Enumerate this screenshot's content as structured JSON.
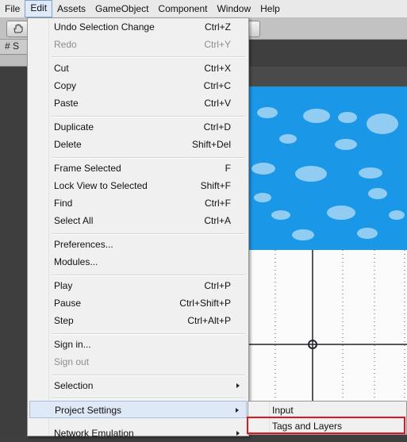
{
  "menubar": {
    "items": [
      {
        "label": "File"
      },
      {
        "label": "Edit"
      },
      {
        "label": "Assets"
      },
      {
        "label": "GameObject"
      },
      {
        "label": "Component"
      },
      {
        "label": "Window"
      },
      {
        "label": "Help"
      }
    ]
  },
  "toolbar": {
    "tab_label": "# S"
  },
  "edit_menu": {
    "undo": {
      "label": "Undo Selection Change",
      "shortcut": "Ctrl+Z"
    },
    "redo": {
      "label": "Redo",
      "shortcut": "Ctrl+Y"
    },
    "cut": {
      "label": "Cut",
      "shortcut": "Ctrl+X"
    },
    "copy": {
      "label": "Copy",
      "shortcut": "Ctrl+C"
    },
    "paste": {
      "label": "Paste",
      "shortcut": "Ctrl+V"
    },
    "duplicate": {
      "label": "Duplicate",
      "shortcut": "Ctrl+D"
    },
    "delete": {
      "label": "Delete",
      "shortcut": "Shift+Del"
    },
    "frame_selected": {
      "label": "Frame Selected",
      "shortcut": "F"
    },
    "lock_view": {
      "label": "Lock View to Selected",
      "shortcut": "Shift+F"
    },
    "find": {
      "label": "Find",
      "shortcut": "Ctrl+F"
    },
    "select_all": {
      "label": "Select All",
      "shortcut": "Ctrl+A"
    },
    "preferences": {
      "label": "Preferences..."
    },
    "modules": {
      "label": "Modules..."
    },
    "play": {
      "label": "Play",
      "shortcut": "Ctrl+P"
    },
    "pause": {
      "label": "Pause",
      "shortcut": "Ctrl+Shift+P"
    },
    "step": {
      "label": "Step",
      "shortcut": "Ctrl+Alt+P"
    },
    "sign_in": {
      "label": "Sign in..."
    },
    "sign_out": {
      "label": "Sign out"
    },
    "selection": {
      "label": "Selection"
    },
    "project_settings": {
      "label": "Project Settings"
    },
    "network_emulation": {
      "label": "Network Emulation"
    }
  },
  "project_settings_submenu": {
    "input": {
      "label": "Input"
    },
    "tags_and_layers": {
      "label": "Tags and Layers"
    }
  },
  "colors": {
    "sky": "#1a97e6",
    "highlight_box": "#e0161e"
  }
}
